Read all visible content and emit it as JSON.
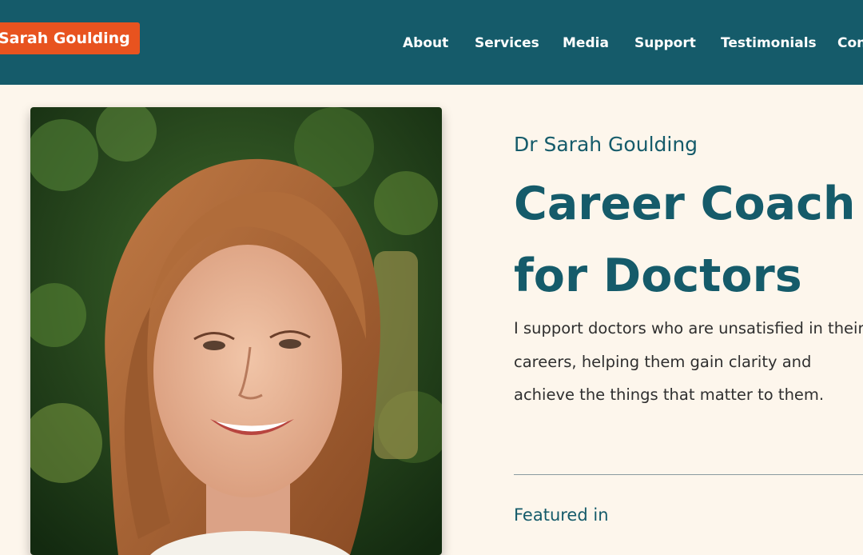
{
  "header": {
    "logo_text": "Sarah Goulding",
    "nav": [
      "About",
      "Services",
      "Media",
      "Support",
      "Testimonials",
      "Contact"
    ]
  },
  "hero": {
    "subtitle": "Dr Sarah Goulding",
    "headline_line1": "Career Coach",
    "headline_line2": "for Doctors",
    "intro": "I support doctors who are unsatisfied in their careers, helping them gain clarity and achieve the things that matter to them.",
    "featured_heading": "Featured in"
  },
  "colors": {
    "header_bg": "#155b6a",
    "logo_badge": "#e8531f",
    "page_bg": "#fdf6ec",
    "heading_text": "#155b6a",
    "body_text": "#2f2f2f"
  }
}
